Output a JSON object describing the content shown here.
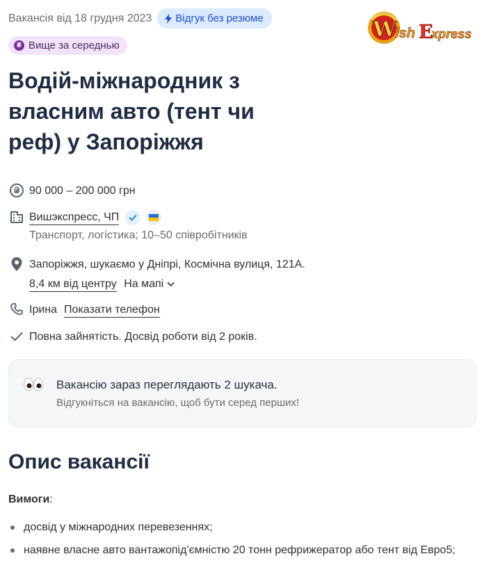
{
  "header": {
    "date": "Вакансія від 18 грудня 2023",
    "quick_badge": "Відгук без резюме",
    "salary_badge": "Вище за середнью",
    "logo_text": "WishExpress"
  },
  "title": "Водій-міжнародник з власним авто (тент чи реф) у Запоріжжя",
  "salary": "90 000 – 200 000 грн",
  "company": {
    "name": "Вишэкспресс, ЧП",
    "description": "Транспорт, логістика; 10–50 співробітників"
  },
  "location": {
    "address": "Запоріжжя, шукаємо у Дніпрі, Космічна вулиця, 121А.",
    "distance": "8,4 км від центру",
    "map_link": "На мапі"
  },
  "contact": {
    "name": "Ірина",
    "phone_link": "Показати телефон"
  },
  "employment": "Повна зайнятість. Досвід роботи від 2 років.",
  "info_card": {
    "line1": "Вакансію зараз переглядають 2 шукача.",
    "line2": "Відгукніться на вакансію, щоб бути серед перших!"
  },
  "description": {
    "heading": "Опис вакансії",
    "requirements_label": "Вимоги",
    "requirements": [
      "досвід у міжнародних перевезеннях;",
      "наявне власне авто вантажопід'ємністю 20 тонн рефрижератор або тент від Евро5;"
    ]
  },
  "colors": {
    "title": "#1f2a44",
    "quick_badge_bg": "#dbeafe",
    "salary_badge_bg": "#f3e2fb"
  }
}
